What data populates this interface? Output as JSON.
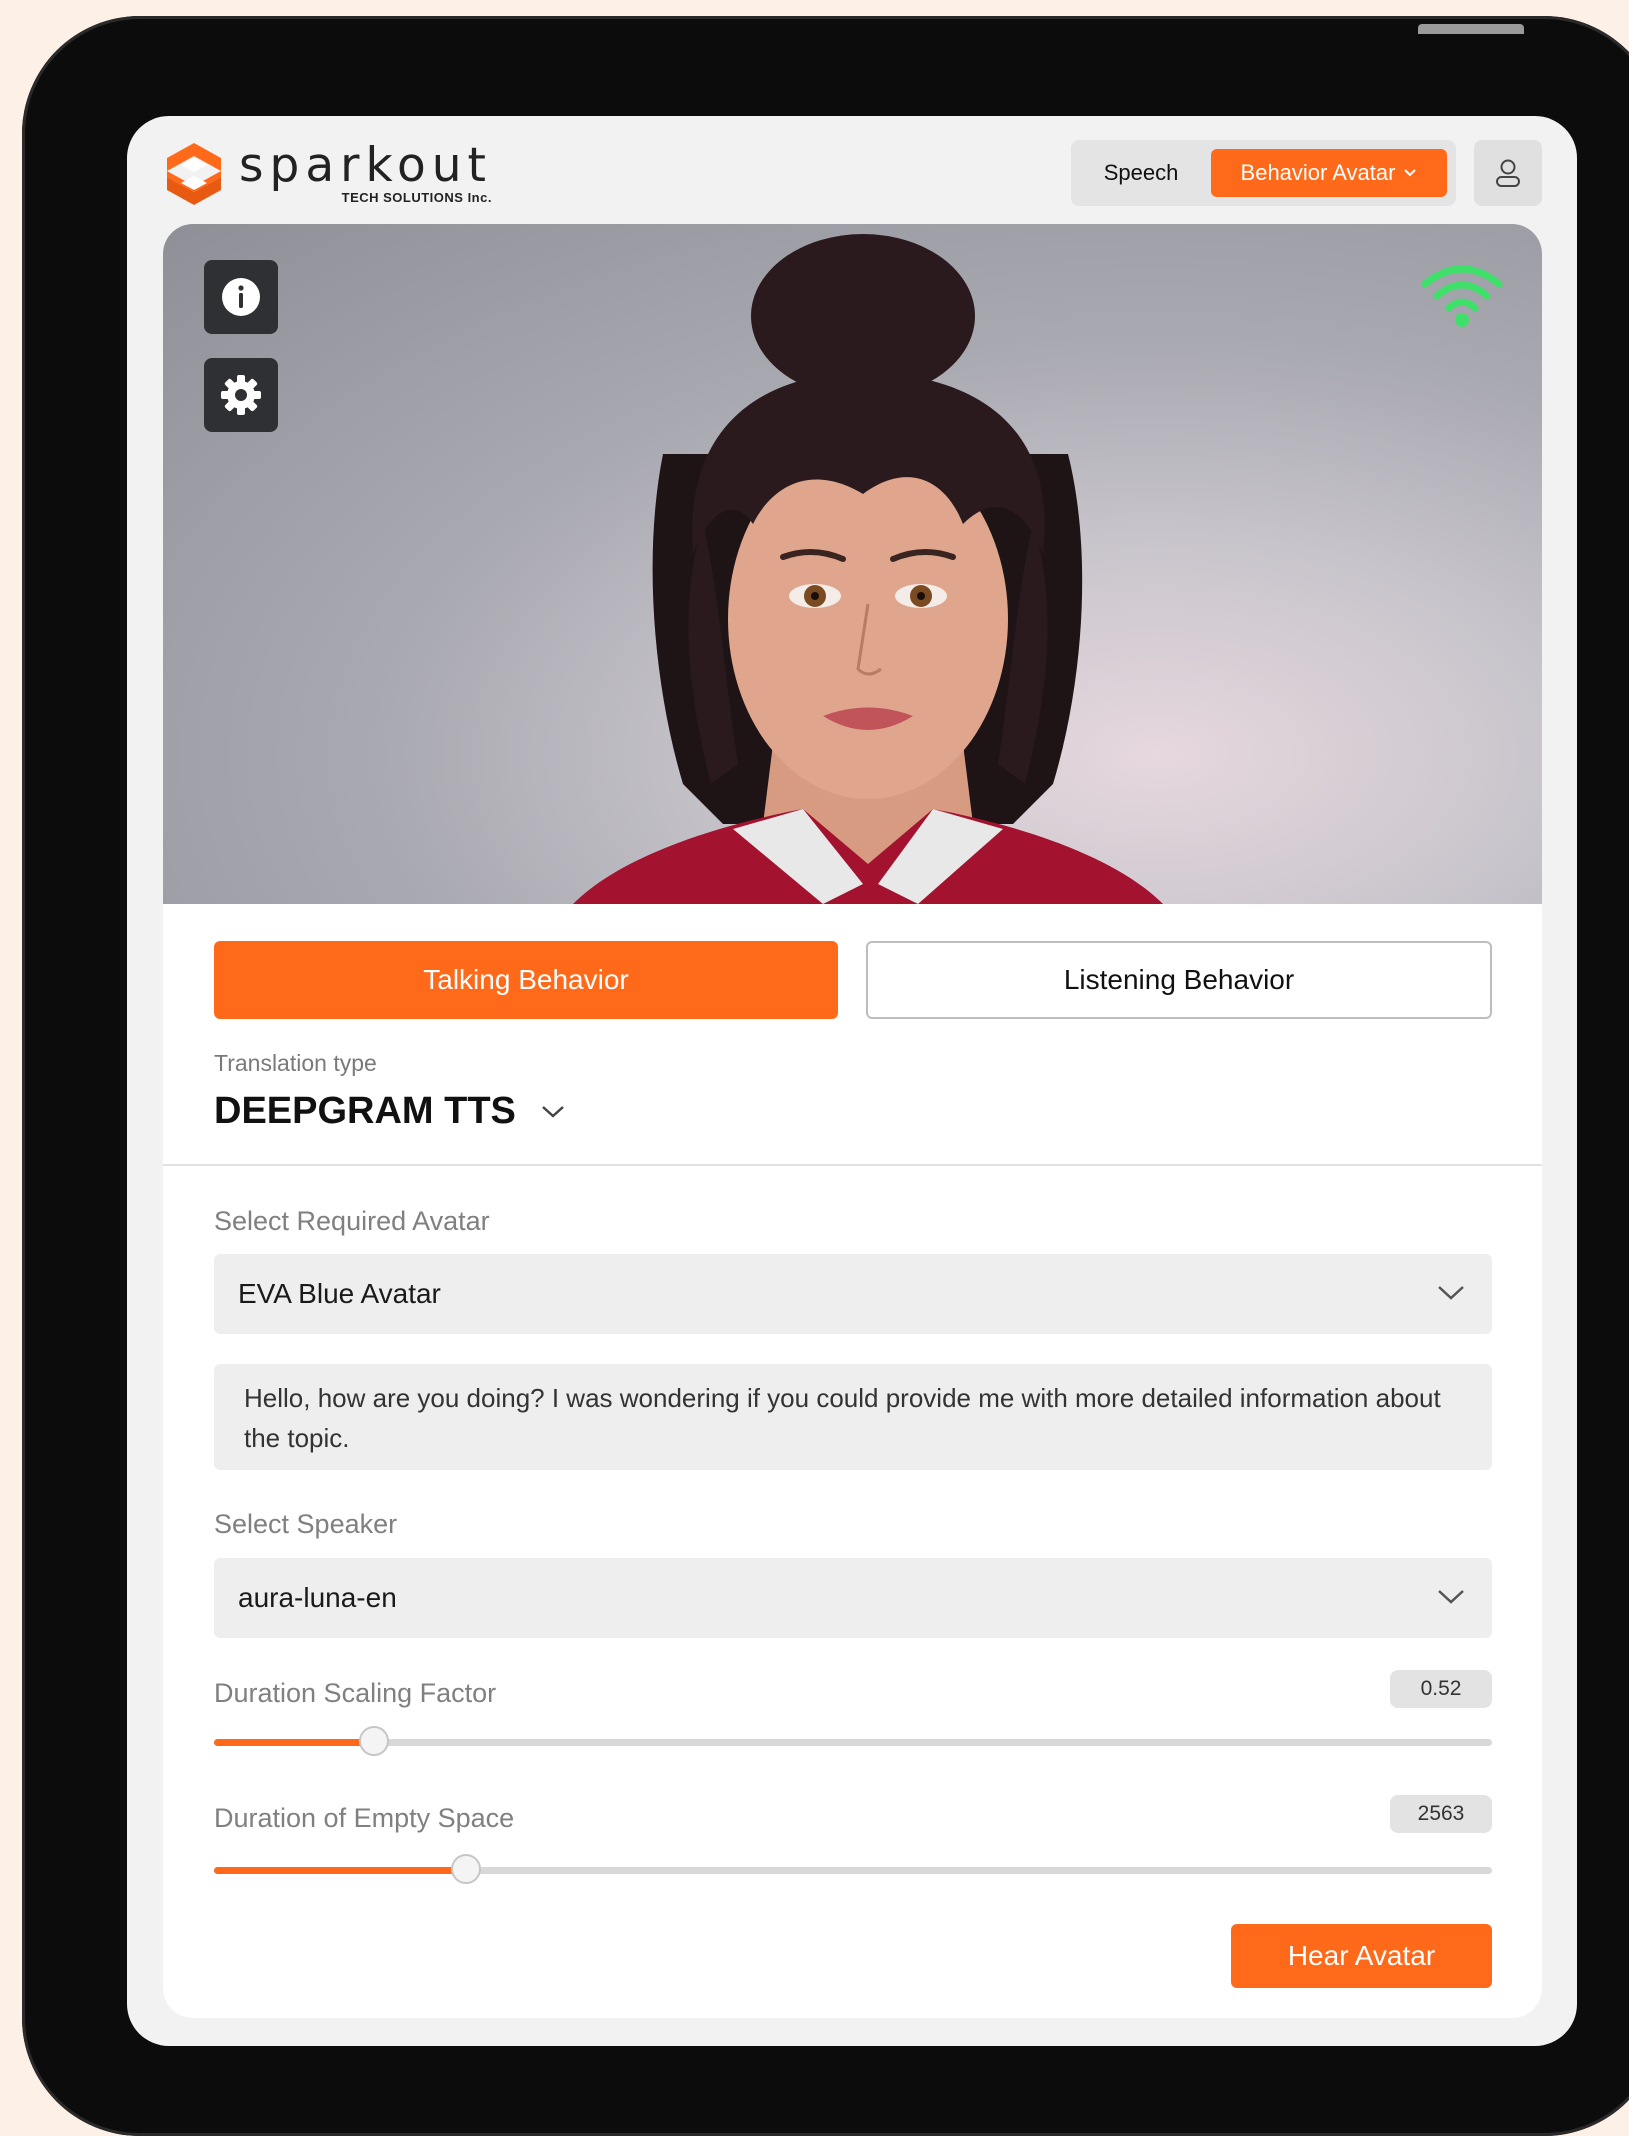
{
  "brand": {
    "name": "sparkout",
    "sub": "TECH SOLUTIONS Inc.",
    "accent": "#ff6a1a"
  },
  "header": {
    "speech_label": "Speech",
    "behavior_label": "Behavior Avatar",
    "user_icon": "user-icon"
  },
  "hero": {
    "info_icon": "info-icon",
    "settings_icon": "gear-icon",
    "signal_icon": "wifi-icon",
    "signal_color": "#3ee06a"
  },
  "tabs": {
    "talking": "Talking Behavior",
    "listening": "Listening Behavior"
  },
  "translation": {
    "label": "Translation type",
    "value": "DEEPGRAM TTS"
  },
  "avatar_select": {
    "label": "Select Required Avatar",
    "value": "EVA Blue Avatar"
  },
  "message": {
    "text": "Hello, how are you doing? I was wondering if you could provide me with more detailed information about the topic."
  },
  "speaker_select": {
    "label": "Select Speaker",
    "value": "aura-luna-en"
  },
  "sliders": {
    "scaling": {
      "label": "Duration Scaling Factor",
      "value": "0.52",
      "fraction": 0.125
    },
    "empty": {
      "label": "Duration of Empty Space",
      "value": "2563",
      "fraction": 0.197
    }
  },
  "actions": {
    "hear": "Hear Avatar"
  }
}
